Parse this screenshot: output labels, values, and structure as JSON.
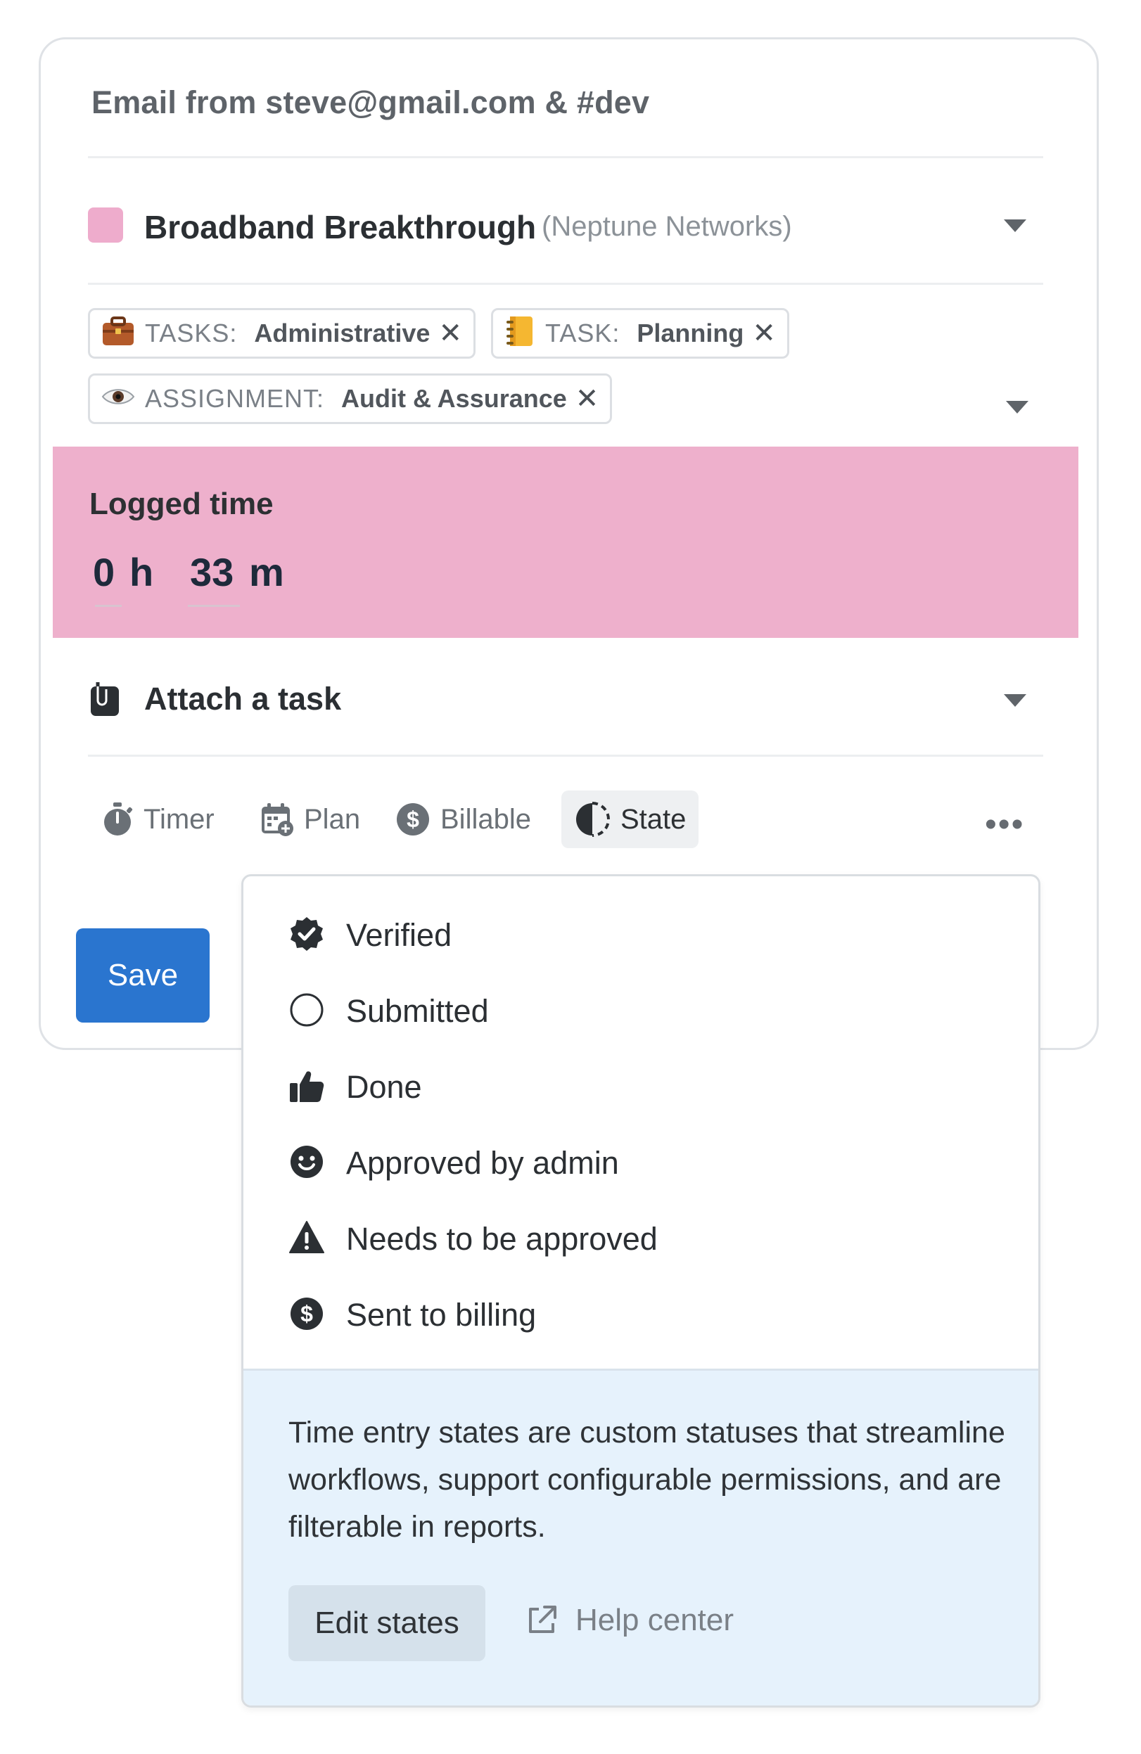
{
  "entry": {
    "description": "Email from steve@gmail.com & #dev",
    "project": {
      "name": "Broadband Breakthrough",
      "client": "(Neptune Networks)",
      "color": "#eeaccc"
    },
    "tags": [
      {
        "icon": "briefcase-icon",
        "key": "TASKS:",
        "value": "Administrative"
      },
      {
        "icon": "notebook-icon",
        "key": "TASK:",
        "value": "Planning"
      },
      {
        "icon": "eye-icon",
        "key": "ASSIGNMENT:",
        "value": "Audit & Assurance"
      }
    ],
    "logged_time": {
      "label": "Logged time",
      "hours": "0",
      "hours_unit": "h",
      "minutes": "33",
      "minutes_unit": "m",
      "background": "#eeb0cc"
    },
    "attach": {
      "label": "Attach a task"
    },
    "toolbar": {
      "timer": "Timer",
      "plan": "Plan",
      "billable": "Billable",
      "state": "State",
      "more": "•••"
    },
    "save_label": "Save"
  },
  "state_menu": {
    "items": [
      {
        "icon": "verified-badge-icon",
        "label": "Verified"
      },
      {
        "icon": "empty-circle-icon",
        "label": "Submitted"
      },
      {
        "icon": "thumbs-up-icon",
        "label": "Done"
      },
      {
        "icon": "smiley-icon",
        "label": "Approved by admin"
      },
      {
        "icon": "warning-icon",
        "label": "Needs to be approved"
      },
      {
        "icon": "dollar-circle-icon",
        "label": "Sent to billing"
      }
    ],
    "info_text": "Time entry states are custom statuses that streamline workflows, support configurable permissions, and are filterable in reports.",
    "edit_label": "Edit states",
    "help_label": "Help center"
  },
  "colors": {
    "primary": "#2a75cf",
    "info_bg": "#e6f2fc"
  }
}
